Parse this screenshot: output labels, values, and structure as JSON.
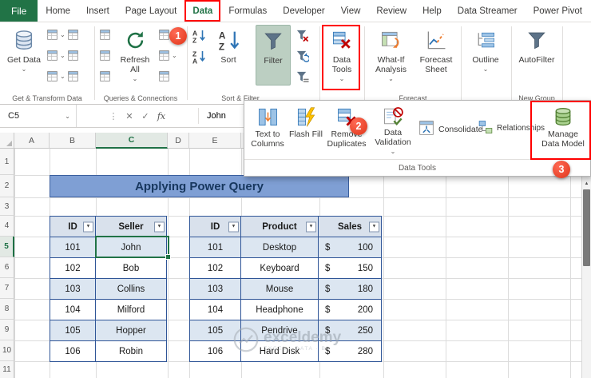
{
  "tabs": [
    "File",
    "Home",
    "Insert",
    "Page Layout",
    "Data",
    "Formulas",
    "Developer",
    "View",
    "Review",
    "Help",
    "Data Streamer",
    "Power Pivot"
  ],
  "ribbon": {
    "get_data": "Get Data",
    "refresh_all": "Refresh All",
    "sort": "Sort",
    "filter": "Filter",
    "data_tools": "Data Tools",
    "what_if": "What-If Analysis",
    "forecast_sheet": "Forecast Sheet",
    "outline": "Outline",
    "autofilter": "AutoFilter",
    "groups": {
      "get_transform": "Get & Transform Data",
      "queries": "Queries & Connections",
      "sort_filter": "Sort & Filter",
      "forecast": "Forecast",
      "new_group": "New Group"
    }
  },
  "menu": {
    "text_to_columns": "Text to Columns",
    "flash_fill": "Flash Fill",
    "remove_duplicates": "Remove Duplicates",
    "data_validation": "Data Validation",
    "consolidate": "Consolidate",
    "relationships": "Relationships",
    "manage_data_model": "Manage Data Model",
    "group_label": "Data Tools"
  },
  "formula_bar": {
    "name_box": "C5",
    "cancel": "✕",
    "enter": "✓",
    "fx": "fx",
    "value": "John"
  },
  "icons": {
    "dropdown": "⌄",
    "filter_arrow": "▼",
    "handle": "⋮",
    "scroll_up": "▲"
  },
  "annotations": {
    "step1": "1",
    "step2": "2",
    "step3": "3"
  },
  "sheet": {
    "columns": [
      "A",
      "B",
      "C",
      "D",
      "E"
    ],
    "rows": [
      "1",
      "2",
      "3",
      "4",
      "5",
      "6",
      "7",
      "8",
      "9",
      "10",
      "11"
    ],
    "title": "Applying Power Query",
    "selected_cell": "C5"
  },
  "table1": {
    "headers": [
      "ID",
      "Seller"
    ],
    "rows": [
      [
        "101",
        "John"
      ],
      [
        "102",
        "Bob"
      ],
      [
        "103",
        "Collins"
      ],
      [
        "104",
        "Milford"
      ],
      [
        "105",
        "Hopper"
      ],
      [
        "106",
        "Robin"
      ]
    ]
  },
  "table2": {
    "headers": [
      "ID",
      "Product",
      "Sales"
    ],
    "currency": "$",
    "rows": [
      [
        "101",
        "Desktop",
        "100"
      ],
      [
        "102",
        "Keyboard",
        "150"
      ],
      [
        "103",
        "Mouse",
        "180"
      ],
      [
        "104",
        "Headphone",
        "200"
      ],
      [
        "105",
        "Pendrive",
        "250"
      ],
      [
        "106",
        "Hard Disk",
        "280"
      ]
    ]
  },
  "watermark": {
    "brand": "exceldemy",
    "tagline": "EXCEL · DATA · BI"
  },
  "colors": {
    "excel_green": "#217346",
    "annotation_red": "#df3519",
    "highlight_red": "#ff0000",
    "banner_bg": "#7f9fd4",
    "banner_text": "#17375e",
    "table_border": "#2f5597",
    "table_alt_fill": "#dce6f1",
    "filter_button_bg": "#bccfc2"
  }
}
